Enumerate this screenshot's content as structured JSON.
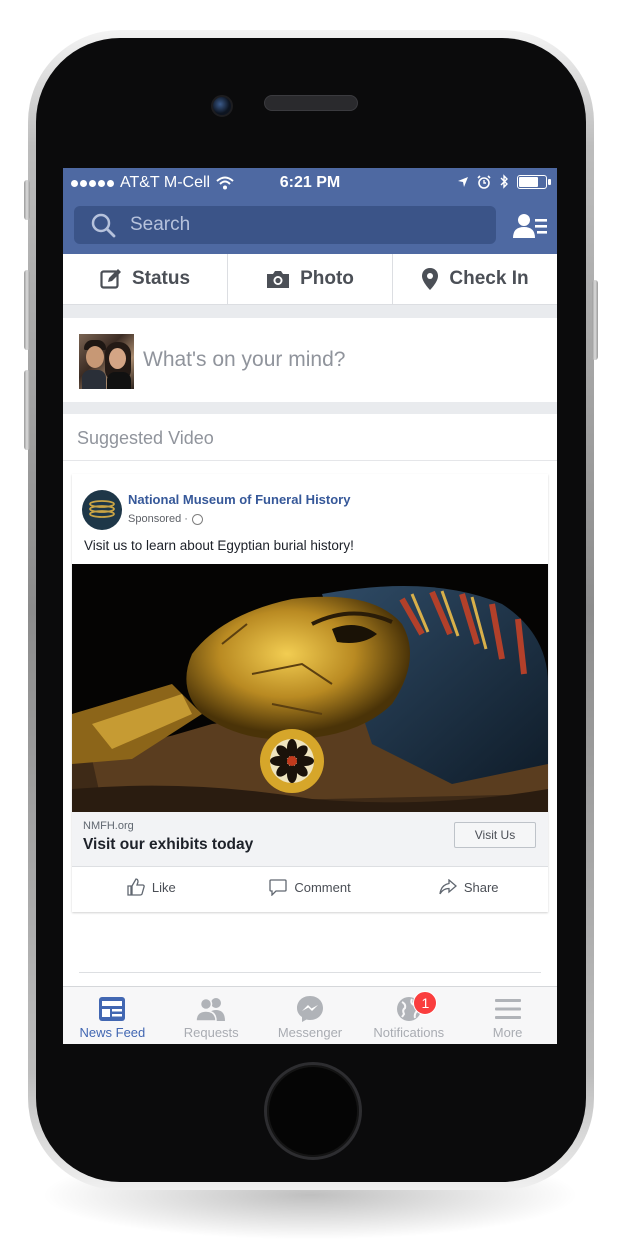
{
  "status_bar": {
    "carrier": "AT&T M-Cell",
    "time": "6:21 PM",
    "battery_level": 0.8
  },
  "header": {
    "search_placeholder": "Search"
  },
  "composer": {
    "status_label": "Status",
    "photo_label": "Photo",
    "checkin_label": "Check In",
    "prompt": "What's on your mind?"
  },
  "suggested": {
    "label": "Suggested Video"
  },
  "post": {
    "page_name": "National Museum of Funeral History",
    "sponsored_label": "Sponsored ·",
    "text": "Visit us to learn about Egyptian burial history!",
    "link_domain": "NMFH.org",
    "link_title": "Visit our exhibits today",
    "cta_label": "Visit Us",
    "like_label": "Like",
    "comment_label": "Comment",
    "share_label": "Share"
  },
  "tab_bar": {
    "tabs": [
      {
        "label": "News Feed",
        "icon": "news-feed-icon",
        "active": true
      },
      {
        "label": "Requests",
        "icon": "friend-requests-icon",
        "active": false
      },
      {
        "label": "Messenger",
        "icon": "messenger-icon",
        "active": false
      },
      {
        "label": "Notifications",
        "icon": "globe-icon",
        "active": false,
        "badge": "1"
      },
      {
        "label": "More",
        "icon": "menu-icon",
        "active": false
      }
    ]
  },
  "colors": {
    "header_blue": "#4e69a2",
    "link_blue": "#365899",
    "active_tab": "#4267b2",
    "badge_red": "#fa3e3e"
  }
}
